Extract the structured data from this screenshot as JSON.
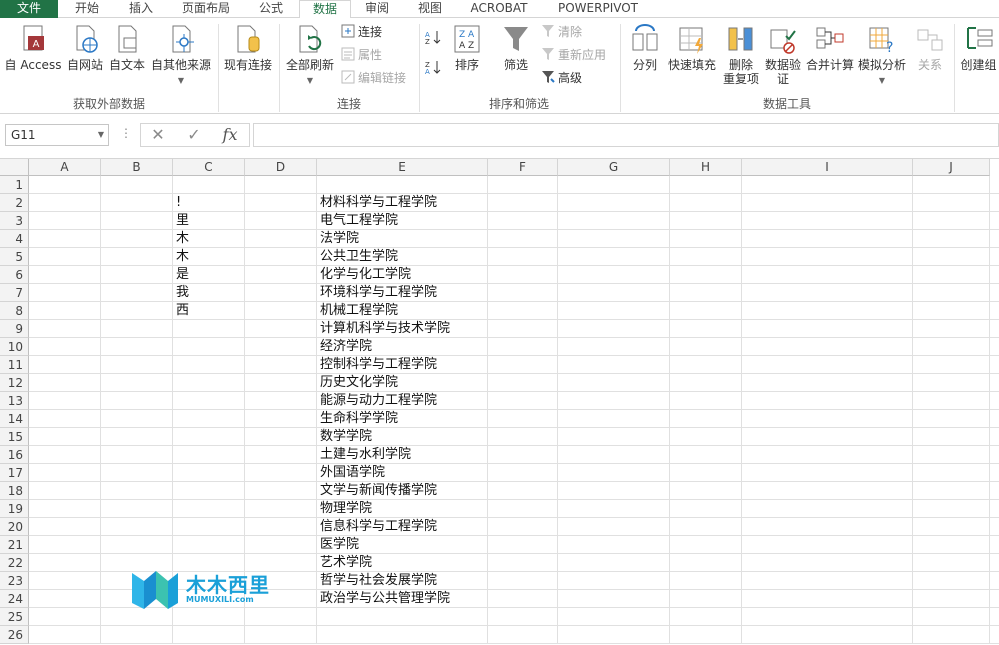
{
  "tabs": [
    {
      "label": "文件"
    },
    {
      "label": "开始"
    },
    {
      "label": "插入"
    },
    {
      "label": "页面布局"
    },
    {
      "label": "公式"
    },
    {
      "label": "数据"
    },
    {
      "label": "审阅"
    },
    {
      "label": "视图"
    },
    {
      "label": "ACROBAT"
    },
    {
      "label": "POWERPIVOT"
    }
  ],
  "ribbon": {
    "external": {
      "label": "获取外部数据",
      "access": "自 Access",
      "web": "自网站",
      "text": "自文本",
      "other": "自其他来源"
    },
    "existing": "现有连接",
    "connections": {
      "label": "连接",
      "refresh_all": "全部刷新",
      "connect": "连接",
      "properties": "属性",
      "edit_links": "编辑链接"
    },
    "sort_filter": {
      "label": "排序和筛选",
      "sort": "排序",
      "filter": "筛选",
      "clear": "清除",
      "reapply": "重新应用",
      "advanced": "高级"
    },
    "tools": {
      "label": "数据工具",
      "split": "分列",
      "flash_fill": "快速填充",
      "remove_dup_1": "删除",
      "remove_dup_2": "重复项",
      "validation_1": "数据验",
      "validation_2": "证",
      "consolidate": "合并计算",
      "whatif": "模拟分析",
      "relations": "关系"
    },
    "group": "创建组"
  },
  "formula_bar": {
    "name_box": "G11",
    "fx": "fx",
    "cancel": "✕",
    "enter": "✓",
    "value": ""
  },
  "columns": [
    "A",
    "B",
    "C",
    "D",
    "E",
    "F",
    "G",
    "H",
    "I",
    "J"
  ],
  "rows": [
    "1",
    "2",
    "3",
    "4",
    "5",
    "6",
    "7",
    "8",
    "9",
    "10",
    "11",
    "12",
    "13",
    "14",
    "15",
    "16",
    "17",
    "18",
    "19",
    "20",
    "21",
    "22",
    "23",
    "24",
    "25",
    "26"
  ],
  "col_c": [
    "",
    "!",
    "里",
    "木",
    "木",
    "是",
    "我",
    "西"
  ],
  "col_e": [
    "",
    "材料科学与工程学院",
    "电气工程学院",
    "法学院",
    "公共卫生学院",
    "化学与化工学院",
    "环境科学与工程学院",
    "机械工程学院",
    "计算机科学与技术学院",
    "经济学院",
    "控制科学与工程学院",
    "历史文化学院",
    "能源与动力工程学院",
    "生命科学学院",
    "数学学院",
    "土建与水利学院",
    "外国语学院",
    "文学与新闻传播学院",
    "物理学院",
    "信息科学与工程学院",
    "医学院",
    "艺术学院",
    "哲学与社会发展学院",
    "政治学与公共管理学院"
  ],
  "watermark": {
    "title": "木木西里",
    "subtitle": "MUMUXILI.com"
  },
  "colors": {
    "excel_green": "#217346",
    "watermark_blue": "#1aa0d8"
  }
}
